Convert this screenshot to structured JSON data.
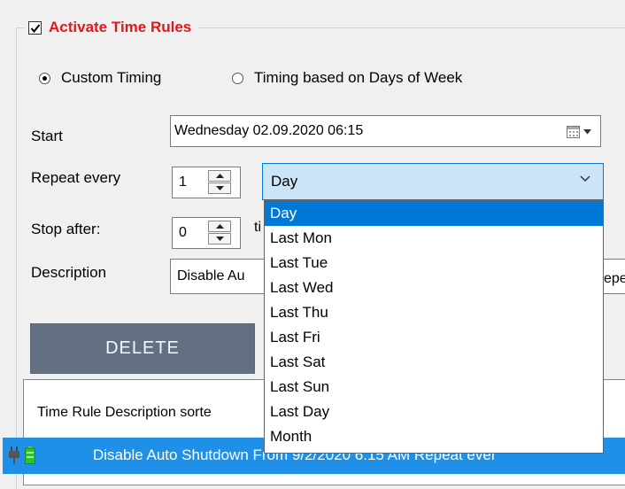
{
  "group": {
    "title": "Activate Time Rules",
    "checked": true
  },
  "timing": {
    "custom_label": "Custom Timing",
    "days_label": "Timing based on Days of Week",
    "selected": "custom"
  },
  "start": {
    "label": "Start",
    "value": "Wednesday 02.09.2020  06:15"
  },
  "repeat": {
    "label": "Repeat every",
    "value": "1",
    "unit": "Day"
  },
  "stop": {
    "label": "Stop after:",
    "value": "0",
    "suffix": "ti"
  },
  "description": {
    "label": "Description",
    "value": "Disable Au",
    "tail": "epe"
  },
  "dropdown": {
    "options": [
      "Day",
      "Last Mon",
      "Last Tue",
      "Last Wed",
      "Last Thu",
      "Last Fri",
      "Last Sat",
      "Last Sun",
      "Last Day",
      "Month"
    ],
    "selected_index": 0
  },
  "buttons": {
    "delete": "DELETE"
  },
  "list": {
    "header": "Time Rule Description sorte",
    "rows": [
      {
        "text": "Disable Auto Shutdown From 9/2/2020 6:15 AM Repeat ever"
      }
    ]
  },
  "colors": {
    "accent": "#0078d7",
    "title_red": "#e8141b",
    "button": "#637082",
    "row": "#1e90e8"
  }
}
